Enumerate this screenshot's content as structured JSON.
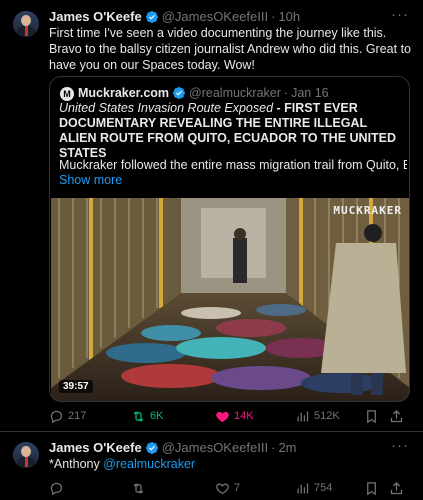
{
  "tweet1": {
    "name": "James O'Keefe",
    "handle": "@JamesOKeefeIII",
    "time": "10h",
    "text": "First time I've seen a video documenting the journey like this. Bravo to the ballsy citizen journalist Andrew who did this. Great to have you on our Spaces today. Wow!",
    "quote": {
      "logo_letter": "M",
      "name": "Muckraker.com",
      "handle": "@realmuckraker",
      "date": "Jan 16",
      "title_italic": "United States Invasion Route Exposed",
      "title_bold": " - FIRST EVER DOCUMENTARY REVEALING THE ENTIRE ILLEGAL ALIEN ROUTE FROM QUITO, ECUADOR TO THE UNITED STATES",
      "body": "Muckraker followed the entire mass migration trail from Quito, Ecuad...",
      "show_more": "Show more",
      "video_duration": "39:57",
      "watermark": "MUCKRAKER"
    },
    "actions": {
      "replies": "217",
      "reposts": "6K",
      "likes": "14K",
      "views": "512K"
    }
  },
  "tweet2": {
    "name": "James O'Keefe",
    "handle": "@JamesOKeefeIII",
    "time": "2m",
    "text_prefix": "*Anthony ",
    "mention": "@realmuckraker",
    "actions": {
      "replies": "",
      "reposts": "",
      "likes": "7",
      "views": "754"
    }
  },
  "colors": {
    "background": "#000000",
    "text": "#e7e9ea",
    "muted": "#71767b",
    "accent": "#1d9bf0",
    "repost": "#00ba7c",
    "like": "#f91880",
    "border": "#2f3336"
  },
  "icons": [
    "verified-badge-icon",
    "more-icon",
    "reply-icon",
    "repost-icon",
    "like-icon",
    "views-icon",
    "bookmark-icon",
    "share-icon"
  ]
}
